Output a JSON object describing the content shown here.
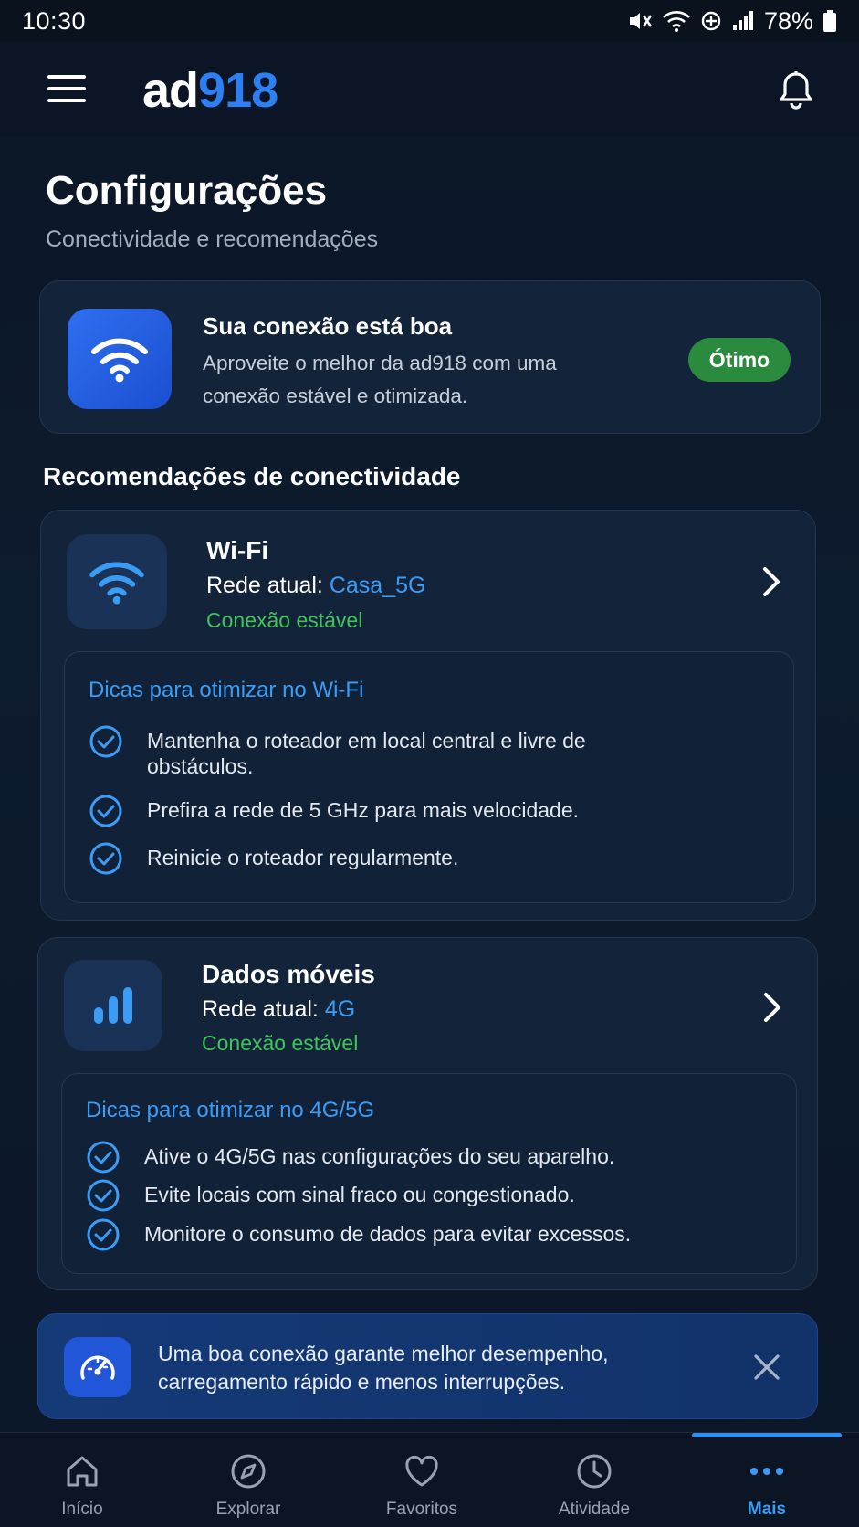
{
  "status_bar": {
    "time": "10:30",
    "battery": "78%"
  },
  "app_bar": {
    "logo_part1": "ad",
    "logo_part2": "918"
  },
  "page": {
    "title": "Configurações",
    "subtitle": "Conectividade e recomendações"
  },
  "connection_status": {
    "title": "Sua conexão está boa",
    "description": "Aproveite o melhor da ad918 com uma conexão estável e otimizada.",
    "badge": "Ótimo",
    "badge_color": "#2a8a3e"
  },
  "section_title": "Recomendações de conectividade",
  "wifi": {
    "name": "Wi-Fi",
    "network_label": "Rede atual:",
    "network_value": "Casa_5G",
    "status": "Conexão estável",
    "tips_title": "Dicas para otimizar no Wi-Fi",
    "tips": [
      "Mantenha o roteador em local central e livre de obstáculos.",
      "Prefira a rede de 5 GHz para mais velocidade.",
      "Reinicie o roteador regularmente."
    ]
  },
  "mobile": {
    "name": "Dados móveis",
    "network_label": "Rede atual:",
    "network_value": "4G",
    "status": "Conexão estável",
    "tips_title": "Dicas para otimizar no 4G/5G",
    "tips": [
      "Ative o 4G/5G nas configurações do seu aparelho.",
      "Evite locais com sinal fraco ou congestionado.",
      "Monitore o consumo de dados para evitar excessos."
    ]
  },
  "info_banner": {
    "text": "Uma boa conexão garante melhor desempenho, carregamento rápido e menos interrupções."
  },
  "bottom_nav": {
    "items": [
      {
        "label": "Início",
        "icon": "home-icon"
      },
      {
        "label": "Explorar",
        "icon": "compass-icon"
      },
      {
        "label": "Favoritos",
        "icon": "heart-icon"
      },
      {
        "label": "Atividade",
        "icon": "clock-icon"
      },
      {
        "label": "Mais",
        "icon": "more-icon",
        "active": true
      }
    ]
  },
  "colors": {
    "accent": "#3a9cf5",
    "success": "#3ec45a",
    "background": "#0d1b2e",
    "card": "#13243a"
  }
}
